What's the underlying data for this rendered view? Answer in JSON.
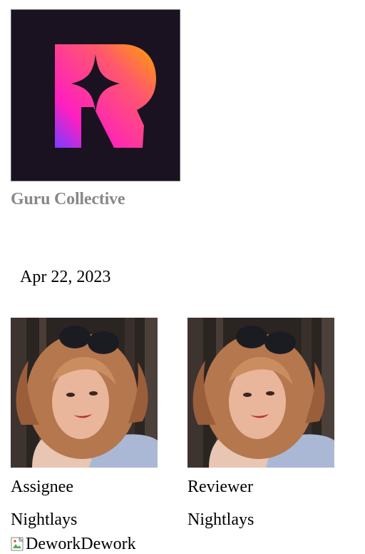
{
  "organization": {
    "logo_letter": "R",
    "logo_icon": "sparkle-r-logo",
    "name": "Guru Collective"
  },
  "date": "Apr 22, 2023",
  "assignee": {
    "role_label": "Assignee",
    "name": "Nightlays",
    "avatar_icon": "user-photo"
  },
  "reviewer": {
    "role_label": "Reviewer",
    "name": "Nightlays",
    "avatar_icon": "user-photo"
  },
  "footer_image": {
    "alt_text": "DeworkDework",
    "icon": "broken-image-icon"
  },
  "colors": {
    "logo_background": "#1a1220",
    "logo_gradient_start": "#ff1fbf",
    "logo_gradient_end": "#ffa400",
    "org_name": "#888888"
  }
}
